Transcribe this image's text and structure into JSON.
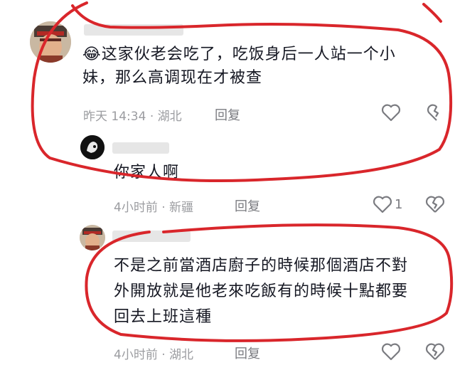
{
  "comments": [
    {
      "emoji": "😂",
      "text_line1": "这家伙老会吃了，吃饭身后一人站一个小",
      "text_line2": "妹，那么高调现在才被查",
      "time": "昨天 14:34",
      "sep": "·",
      "location": "湖北",
      "reply_label": "回复"
    },
    {
      "text": "你家人啊",
      "time": "4小时前",
      "sep": "·",
      "location": "新疆",
      "reply_label": "回复",
      "likes": "1"
    },
    {
      "text_line1": "不是之前當酒店廚子的時候那個酒店不對",
      "text_line2": "外開放就是他老來吃飯有的時候十點都要",
      "text_line3": "回去上班這種",
      "time": "4小时前",
      "sep": "·",
      "location": "湖北",
      "reply_label": "回复"
    }
  ],
  "colors": {
    "annotation": "#d9262b",
    "meta": "#9b9ca0",
    "text": "#161823"
  },
  "icons": [
    "heart-icon",
    "dislike-broken-heart-icon"
  ]
}
